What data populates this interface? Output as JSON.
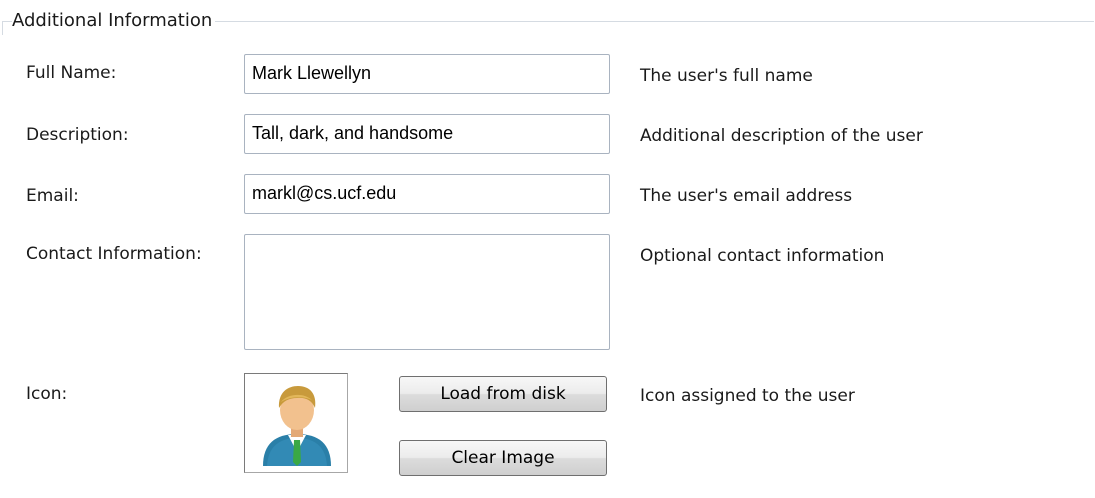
{
  "group": {
    "title": "Additional Information"
  },
  "fields": {
    "full_name": {
      "label": "Full Name:",
      "value": "Mark Llewellyn",
      "help": "The user's full name"
    },
    "description": {
      "label": "Description:",
      "value": "Tall, dark, and handsome",
      "help": "Additional description of the user"
    },
    "email": {
      "label": "Email:",
      "value": "markl@cs.ucf.edu",
      "help": "The user's email address"
    },
    "contact": {
      "label": "Contact Information:",
      "value": "",
      "help": "Optional contact information"
    },
    "icon": {
      "label": "Icon:",
      "help": "Icon assigned to the user",
      "load_label": "Load from disk",
      "clear_label": "Clear Image",
      "image_icon": "user-avatar-icon"
    }
  },
  "colors": {
    "avatar_hair": "#c89a3c",
    "avatar_skin": "#f2c18e",
    "avatar_suit": "#2a7fa8",
    "avatar_tie": "#3aa845"
  }
}
